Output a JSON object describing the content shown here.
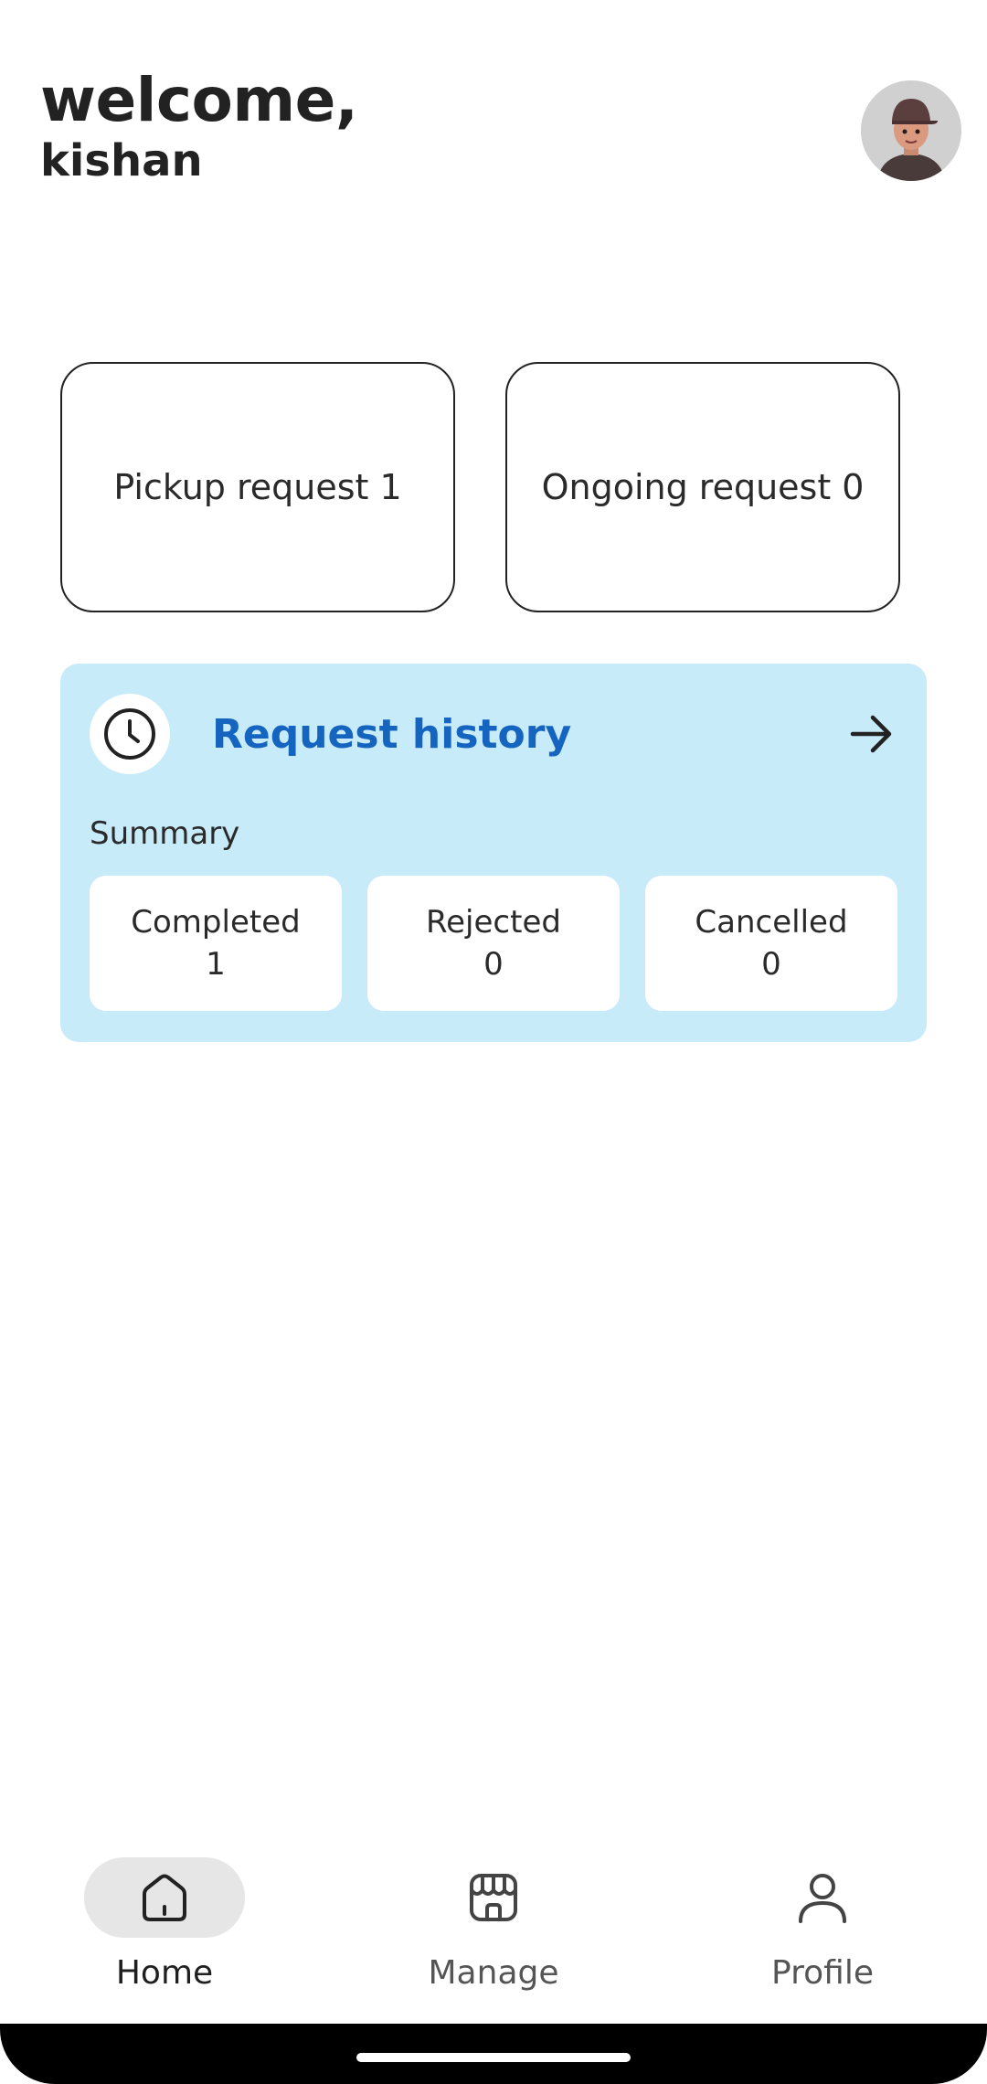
{
  "header": {
    "greeting": "welcome,",
    "username": "kishan"
  },
  "stats": {
    "pickup": {
      "label": "Pickup request",
      "count": "1"
    },
    "ongoing": {
      "label": "Ongoing request",
      "count": "0"
    }
  },
  "history": {
    "title": "Request history",
    "summary_label": "Summary",
    "summary": [
      {
        "label": "Completed",
        "value": "1"
      },
      {
        "label": "Rejected",
        "value": "0"
      },
      {
        "label": "Cancelled",
        "value": "0"
      }
    ],
    "accent_color": "#1565c0",
    "background_color": "#c8ebfa"
  },
  "nav": {
    "items": [
      {
        "label": "Home",
        "icon": "home-icon",
        "active": true
      },
      {
        "label": "Manage",
        "icon": "store-icon",
        "active": false
      },
      {
        "label": "Profile",
        "icon": "person-icon",
        "active": false
      }
    ]
  }
}
